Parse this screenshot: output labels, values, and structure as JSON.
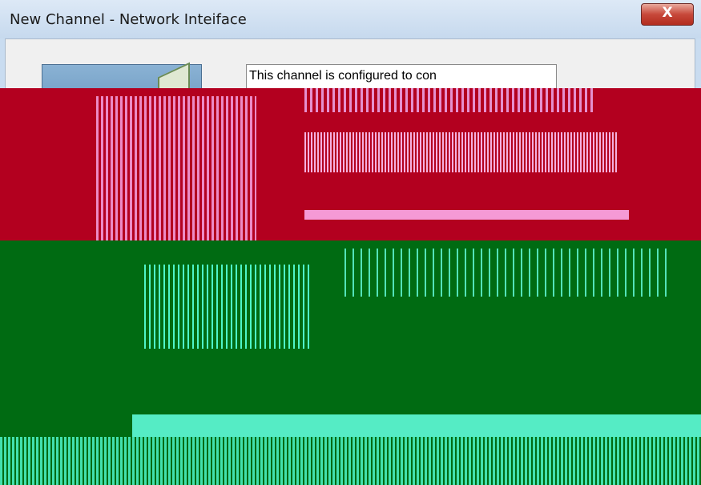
{
  "window": {
    "title": "New Channel - Network Inteiface",
    "close_symbol": "X"
  },
  "wizard": {
    "image_icon": "wizard-banner-icon",
    "description": "This channel is configured to con"
  },
  "colors": {
    "titlebar": "#c6d9ee",
    "close_button": "#c7483a",
    "client_bg": "#f0f0f0",
    "glitch_red": "#b3001f",
    "glitch_green": "#006b12"
  }
}
